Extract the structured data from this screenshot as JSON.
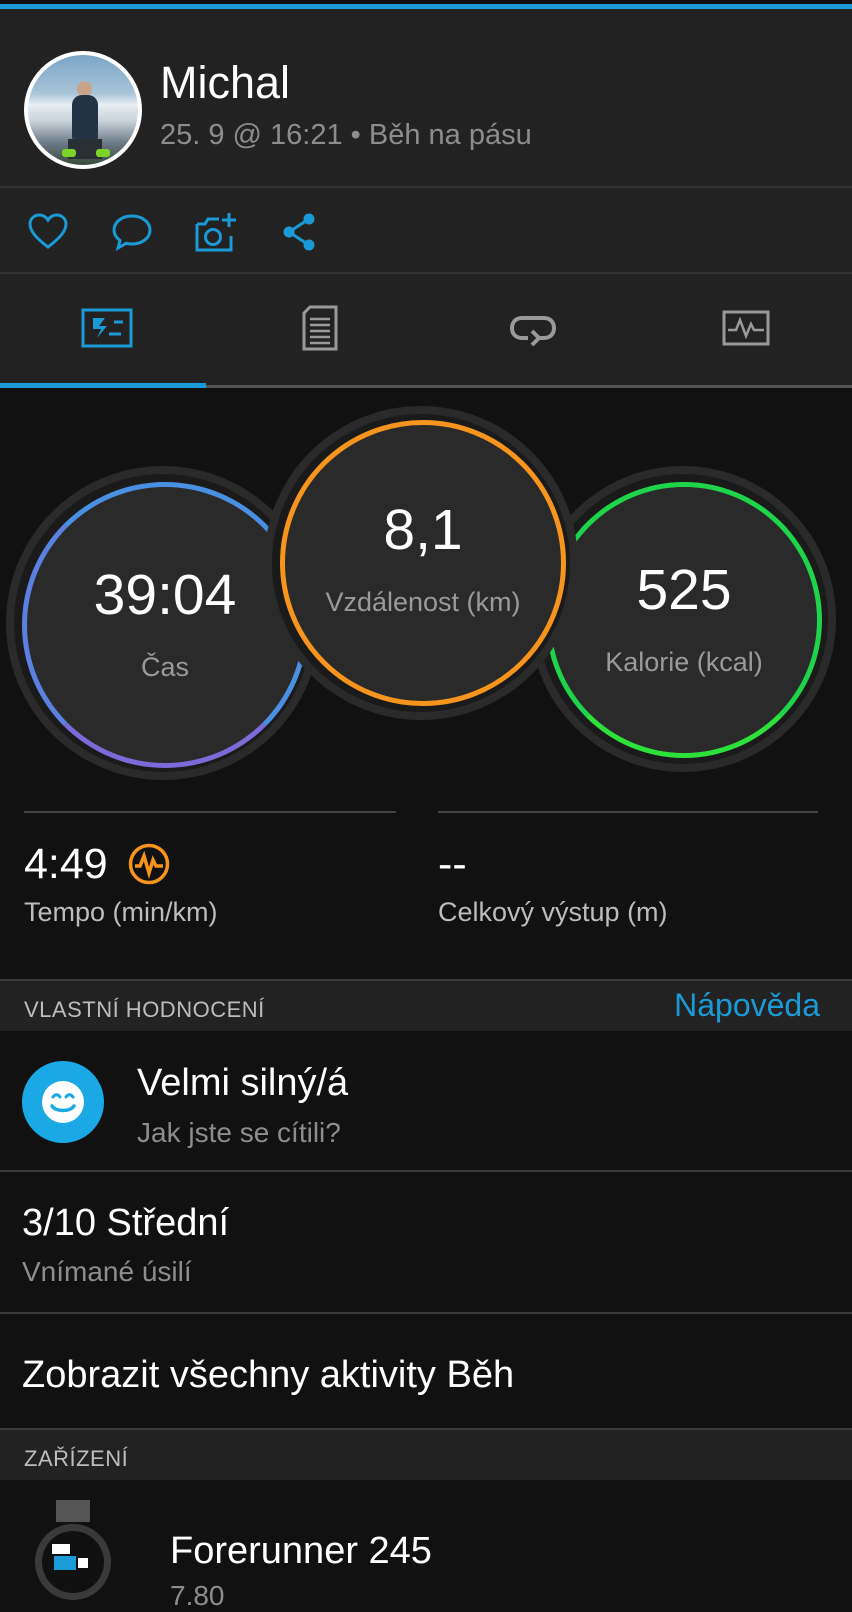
{
  "header": {
    "user_name": "Michal",
    "meta": "25. 9 @ 16:21 • Běh na pásu"
  },
  "actions": [
    "heart-icon",
    "comment-icon",
    "add-photo-icon",
    "share-icon"
  ],
  "tabs": [
    "overview-tab",
    "details-tab",
    "laps-tab",
    "charts-tab"
  ],
  "stats": {
    "time": {
      "value": "39:04",
      "label": "Čas",
      "color": "#4a90e2"
    },
    "distance": {
      "value": "8,1",
      "label": "Vzdálenost (km)",
      "color": "#f7941d"
    },
    "calories": {
      "value": "525",
      "label": "Kalorie (kcal)",
      "color": "#1fd34a"
    },
    "pace": {
      "value": "4:49",
      "label": "Tempo (min/km)"
    },
    "ascent": {
      "value": "--",
      "label": "Celkový výstup (m)"
    }
  },
  "self_eval": {
    "section_title": "VLASTNÍ HODNOCENÍ",
    "help": "Nápověda",
    "feeling_title": "Velmi silný/á",
    "feeling_sub": "Jak jste se cítili?",
    "effort_title": "3/10 Střední",
    "effort_sub": "Vnímané úsilí"
  },
  "view_all": "Zobrazit všechny aktivity Běh",
  "device": {
    "section_title": "ZAŘÍZENÍ",
    "name": "Forerunner 245",
    "version": "7.80"
  },
  "colors": {
    "accent": "#1a9bd7"
  }
}
